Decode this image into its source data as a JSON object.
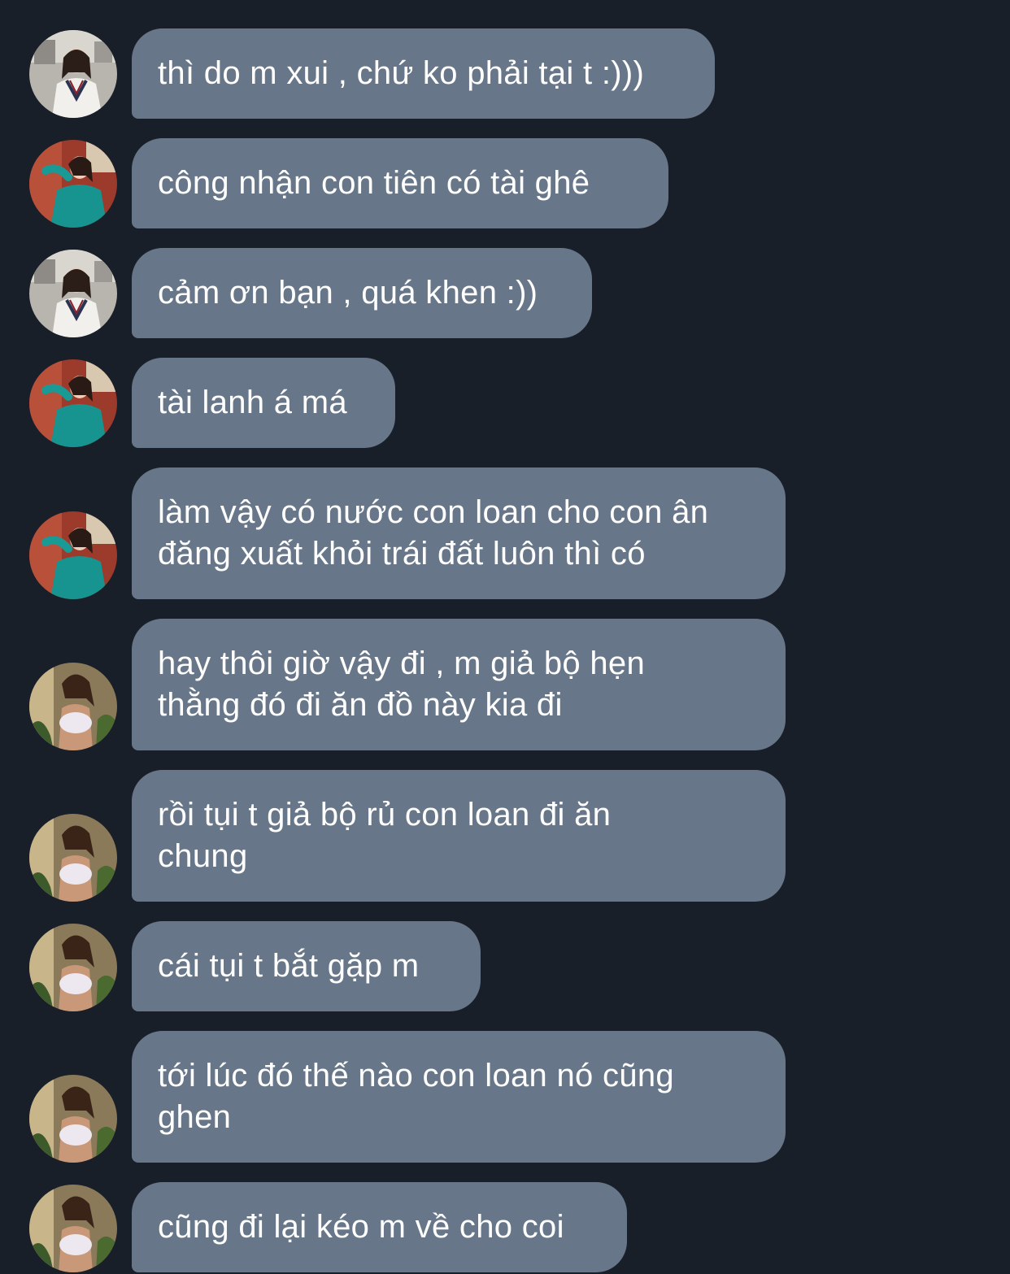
{
  "messages": [
    {
      "text": "thì do m xui , chứ ko phải tại t :)))",
      "avatar": "white-sweater"
    },
    {
      "text": "công nhận con tiên có tài ghê",
      "avatar": "teal-dress"
    },
    {
      "text": "cảm ơn bạn , quá khen :))",
      "avatar": "white-sweater"
    },
    {
      "text": "tài lanh á má",
      "avatar": "teal-dress"
    },
    {
      "text": "làm vậy có nước con loan cho con ân\nđăng xuất khỏi trái đất luôn thì có",
      "avatar": "teal-dress"
    },
    {
      "text": "hay thôi giờ vậy đi , m giả bộ hẹn\nthằng đó đi ăn đồ này kia đi",
      "avatar": "white-sports-top"
    },
    {
      "text": "rồi tụi t giả bộ rủ con loan đi ăn\nchung",
      "avatar": "white-sports-top"
    },
    {
      "text": "cái tụi t bắt gặp m",
      "avatar": "white-sports-top"
    },
    {
      "text": "tới lúc đó thế nào con loan nó cũng\nghen",
      "avatar": "white-sports-top"
    },
    {
      "text": "cũng đi lại kéo m về cho coi",
      "avatar": "white-sports-top"
    }
  ],
  "colors": {
    "background": "#181f29",
    "bubble": "#677688",
    "text": "#ffffff"
  }
}
